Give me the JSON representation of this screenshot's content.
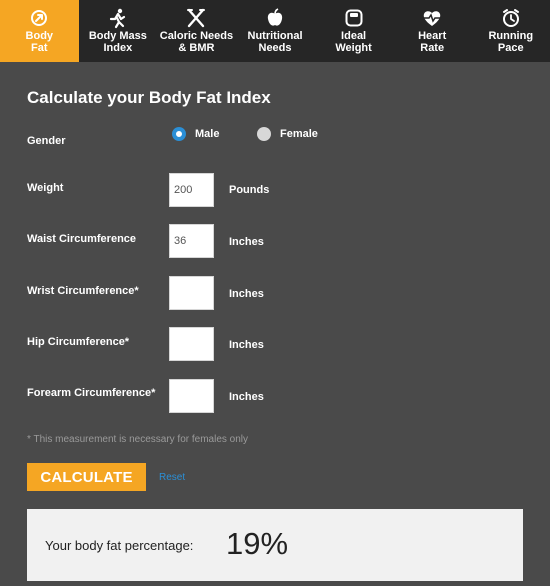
{
  "nav": {
    "items": [
      {
        "label": "Body\nFat",
        "icon": "body-fat-icon",
        "active": true
      },
      {
        "label": "Body Mass\nIndex",
        "icon": "running-person-icon",
        "active": false
      },
      {
        "label": "Caloric Needs\n& BMR",
        "icon": "fork-knife-icon",
        "active": false
      },
      {
        "label": "Nutritional\nNeeds",
        "icon": "apple-icon",
        "active": false
      },
      {
        "label": "Ideal\nWeight",
        "icon": "scale-icon",
        "active": false
      },
      {
        "label": "Heart\nRate",
        "icon": "heart-rate-icon",
        "active": false
      },
      {
        "label": "Running\nPace",
        "icon": "stopwatch-icon",
        "active": false
      }
    ]
  },
  "form": {
    "title": "Calculate your Body Fat Index",
    "gender": {
      "label": "Gender",
      "options": [
        {
          "label": "Male",
          "checked": true
        },
        {
          "label": "Female",
          "checked": false
        }
      ]
    },
    "weight": {
      "label": "Weight",
      "value": "200",
      "unit": "Pounds"
    },
    "waist": {
      "label": "Waist Circumference",
      "value": "36",
      "unit": "Inches"
    },
    "wrist": {
      "label": "Wrist Circumference*",
      "value": "",
      "unit": "Inches"
    },
    "hip": {
      "label": "Hip Circumference*",
      "value": "",
      "unit": "Inches"
    },
    "forearm": {
      "label": "Forearm Circumference*",
      "value": "",
      "unit": "Inches"
    },
    "note": "* This measurement is necessary for females only",
    "calculate_label": "CALCULATE",
    "reset_label": "Reset"
  },
  "result": {
    "label": "Your body fat percentage:",
    "value": "19%"
  },
  "colors": {
    "accent": "#f5a623",
    "nav_bg": "#262626",
    "panel_bg": "#4a4a4a",
    "link": "#2b8fd6",
    "radio_checked": "#2b8fd6"
  }
}
